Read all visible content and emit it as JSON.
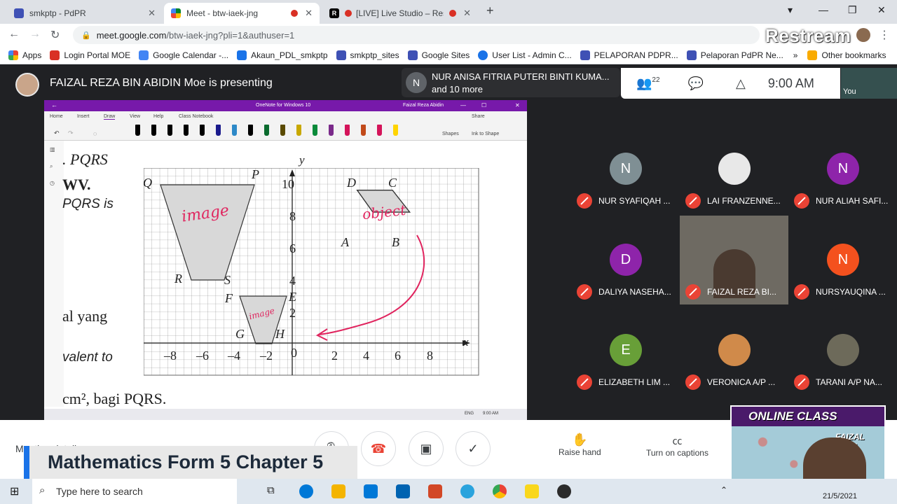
{
  "browser": {
    "tabs": [
      {
        "title": "smkptp - PdPR",
        "active": false,
        "favicon_color": "#3f51b5"
      },
      {
        "title": "Meet - btw-iaek-jng",
        "active": true,
        "favicon_color": "#00832d"
      },
      {
        "title": "[LIVE] Live Studio – Restr",
        "active": false,
        "favicon_color": "#000000"
      }
    ],
    "new_tab": "+",
    "url_host": "meet.google.com",
    "url_path": "/btw-iaek-jng?pli=1&authuser=1",
    "overlay_logo": "Restream"
  },
  "bookmarks": {
    "items": [
      "Apps",
      "Login Portal MOE",
      "Google Calendar -...",
      "Akaun_PDL_smkptp",
      "smkptp_sites",
      "Google Sites",
      "User List - Admin C...",
      "PELAPORAN PDPR...",
      "Pelaporan PdPR Ne..."
    ],
    "overflow": "»",
    "other": "Other bookmarks"
  },
  "meet": {
    "presenting_text": "FAIZAL REZA BIN ABIDIN Moe is presenting",
    "speaker_initial": "N",
    "speaker_name": "NUR ANISA FITRIA PUTERI BINTI KUMA...",
    "speaker_more": "and 10 more",
    "people_count": "22",
    "time": "9:00 AM",
    "self_label": "You"
  },
  "onenote": {
    "title": "OneNote for Windows 10",
    "user": "Faizal Reza Abidin",
    "menu": [
      "Home",
      "Insert",
      "Draw",
      "View",
      "Help",
      "Class Notebook"
    ],
    "active_menu": "Draw",
    "share": "Share",
    "shapes": "Shapes",
    "ink_to_shape": "Ink to Shape",
    "taskbar_time": "9:00 AM",
    "taskbar_lang": "ENG",
    "pen_colors": [
      "#000000",
      "#000000",
      "#000000",
      "#000000",
      "#000000",
      "#1a1a8c",
      "#2d89c8",
      "#000000",
      "#0a6b2e",
      "#5a4a00",
      "#c8a800",
      "#0a8a3a",
      "#7a2a8a",
      "#d4145a",
      "#c14a1a",
      "#d4145a",
      "#ffd400"
    ]
  },
  "book": {
    "left_text": [
      ". PQRS",
      "WV.",
      "PQRS is",
      "al yang",
      "valent to",
      "cm², bagi PQRS."
    ]
  },
  "graph": {
    "axis_y": "y",
    "axis_x": "x",
    "x_ticks": [
      "–8",
      "–6",
      "–4",
      "–2",
      "0",
      "2",
      "4",
      "6",
      "8"
    ],
    "y_ticks": [
      "10",
      "8",
      "6",
      "4",
      "2"
    ],
    "vertex_labels": [
      "Q",
      "P",
      "R",
      "S",
      "D",
      "C",
      "A",
      "B",
      "F",
      "E",
      "G",
      "H"
    ],
    "annotations": {
      "image_big": "image",
      "image_small": "image",
      "object": "object"
    }
  },
  "participants": [
    {
      "initial": "N",
      "name": "NUR SYAFIQAH ...",
      "color": "#7f8f94"
    },
    {
      "initial": "",
      "name": "LAI FRANZENNE...",
      "color": "#e8e8e8"
    },
    {
      "initial": "N",
      "name": "NUR ALIAH SAFI...",
      "color": "#8e24aa"
    },
    {
      "initial": "D",
      "name": "DALIYA NASEHA...",
      "color": "#8e24aa"
    },
    {
      "initial": "",
      "name": "FAIZAL REZA BI...",
      "color": "#6e6a62"
    },
    {
      "initial": "N",
      "name": "NURSYAUQINA ...",
      "color": "#f4511e"
    },
    {
      "initial": "E",
      "name": "ELIZABETH LIM ...",
      "color": "#689f38"
    },
    {
      "initial": "",
      "name": "VERONICA A/P ...",
      "color": "#d08a4a"
    },
    {
      "initial": "",
      "name": "TARANI A/P NA...",
      "color": "#6d6a5a"
    }
  ],
  "bottom": {
    "meeting_details": "Meeting details",
    "raise_hand": "Raise hand",
    "captions": "Turn on captions",
    "banner": "Mathematics Form 5 Chapter 5",
    "online_class": "ONLINE CLASS",
    "online_class_name": "FAIZAL REZA"
  },
  "taskbar": {
    "search_placeholder": "Type here to search",
    "date": "21/5/2021"
  }
}
